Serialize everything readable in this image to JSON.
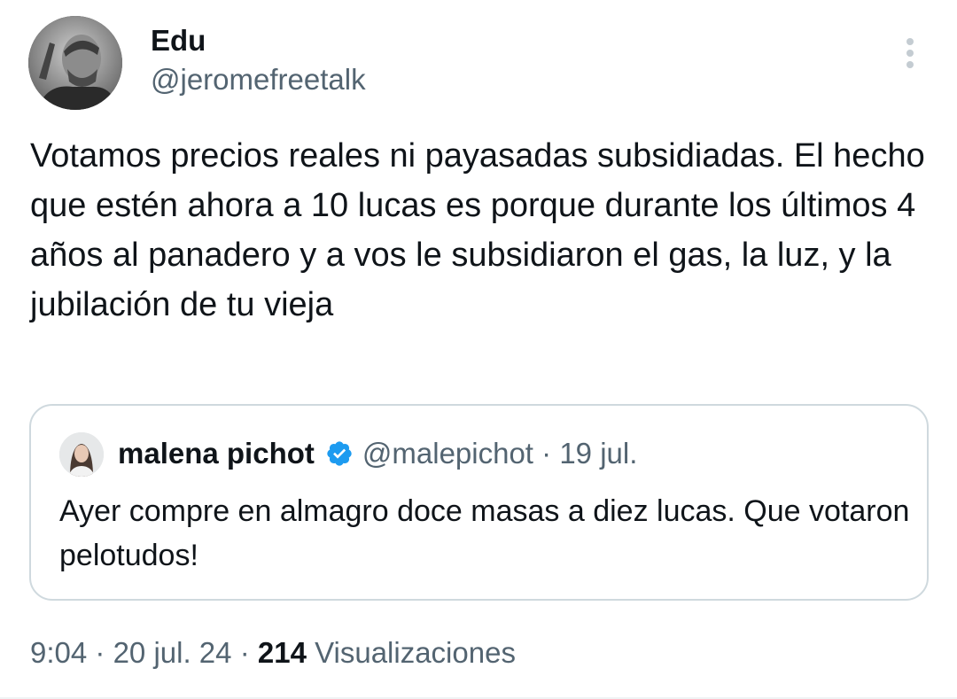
{
  "tweet": {
    "author": {
      "name": "Edu",
      "handle": "@jeromefreetalk"
    },
    "text": "Votamos precios reales ni payasadas subsidiadas. El hecho que estén ahora a 10 lucas es porque durante los últimos 4 años al panadero y a vos le subsidiaron el gas, la luz, y la jubilación de tu vieja",
    "time": "9:04",
    "date": "20 jul. 24",
    "views_count": "214",
    "views_label": "Visualizaciones",
    "separator": "·"
  },
  "quote": {
    "name": "malena pichot",
    "verified": true,
    "handle": "@malepichot",
    "date": "19 jul.",
    "separator": "·",
    "text": "Ayer compre en almagro doce masas a diez lucas. Que votaron pelotudos!"
  },
  "colors": {
    "text_primary": "#0f1419",
    "text_secondary": "#536471",
    "border": "#cfd9de",
    "verified_blue": "#1d9bf0"
  },
  "icons": {
    "more": "more-vertical-icon",
    "verified": "verified-badge-icon"
  }
}
